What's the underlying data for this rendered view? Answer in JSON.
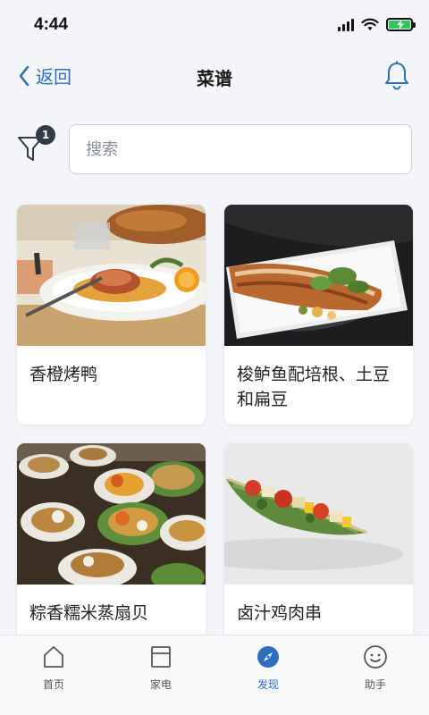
{
  "status_bar": {
    "time": "4:44"
  },
  "nav": {
    "back_label": "返回",
    "title": "菜谱"
  },
  "filter": {
    "badge_count": "1"
  },
  "search": {
    "placeholder": "搜索"
  },
  "recipes": [
    {
      "title": "香橙烤鸭",
      "image": "roast-duck-photo"
    },
    {
      "title": "梭鲈鱼配培根、土豆和扁豆",
      "image": "fish-bacon-photo"
    },
    {
      "title": "粽香糯米蒸扇贝",
      "image": "scallop-photo"
    },
    {
      "title": "卤汁鸡肉串",
      "image": "chicken-skewer-photo"
    }
  ],
  "tabs": [
    {
      "label": "首页",
      "icon": "home-icon",
      "active": false
    },
    {
      "label": "家电",
      "icon": "appliance-icon",
      "active": false
    },
    {
      "label": "发现",
      "icon": "compass-icon",
      "active": true
    },
    {
      "label": "助手",
      "icon": "smiley-icon",
      "active": false
    }
  ],
  "colors": {
    "accent": "#2c6fbf",
    "background": "#f3f5f8"
  }
}
